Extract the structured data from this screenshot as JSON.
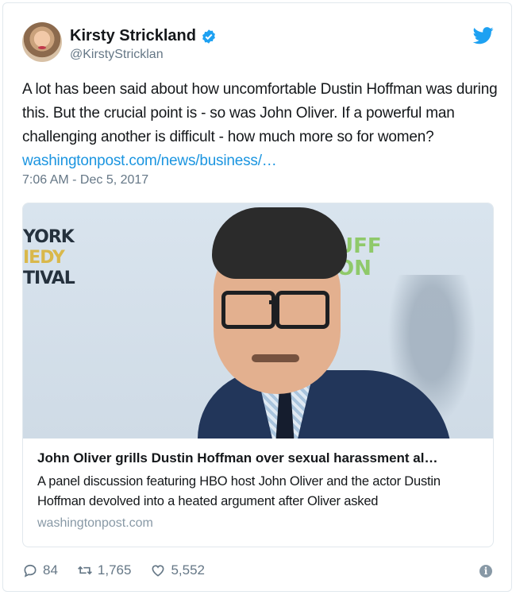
{
  "author": {
    "name": "Kirsty Strickland",
    "handle": "@KirstyStricklan"
  },
  "tweet": {
    "text": "A lot has been said about how uncomfortable Dustin Hoffman was during this. But the crucial point is - so was John Oliver. If a powerful man challenging another is difficult - how much more so for women?",
    "link_text": "washingtonpost.com/news/business/…",
    "timestamp": "7:06 AM - Dec 5, 2017"
  },
  "card": {
    "backdrop_lines": [
      "YORK",
      "IEDY",
      "TIVAL"
    ],
    "backdrop_right_lines": [
      "UFF",
      "ON"
    ],
    "title": "John Oliver grills Dustin Hoffman over sexual harassment al…",
    "description": "A panel discussion featuring HBO host John Oliver and the actor Dustin Hoffman devolved into a heated argument after Oliver asked",
    "domain": "washingtonpost.com"
  },
  "actions": {
    "replies": "84",
    "retweets": "1,765",
    "likes": "5,552"
  },
  "icons": {
    "reply": "speech-bubble-icon",
    "retweet": "retweet-icon",
    "like": "heart-icon",
    "info": "info-icon",
    "verified": "verified-badge-icon",
    "brand": "twitter-bird-icon"
  },
  "colors": {
    "link": "#1b95e0",
    "verified": "#1da1f2",
    "muted": "#657786"
  }
}
